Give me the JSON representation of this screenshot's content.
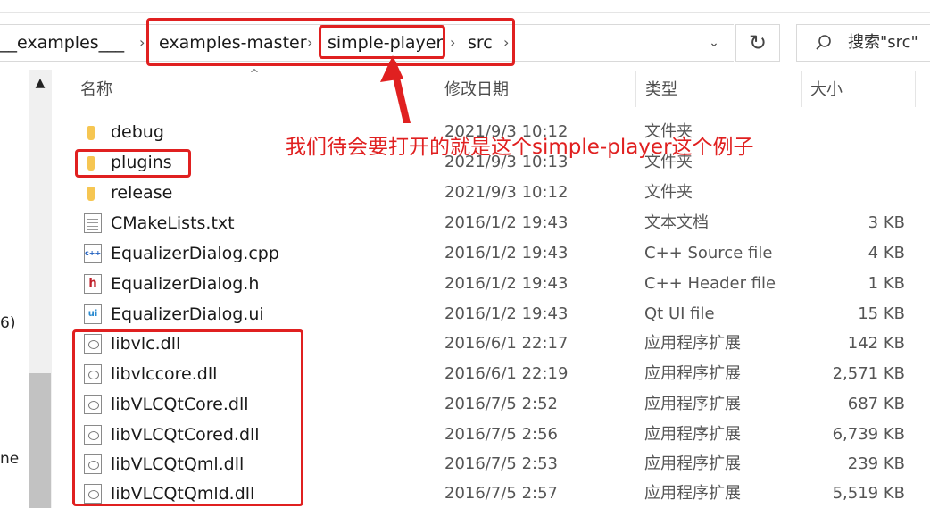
{
  "address_bar": {
    "crumbs": [
      "__examples___",
      "examples-master",
      "simple-player",
      "src"
    ],
    "separator": "›",
    "dropdown_glyph": "⌄",
    "refresh_glyph": "↻"
  },
  "search": {
    "placeholder": "搜索\"src\"",
    "icon": "search-icon"
  },
  "nav_pane": {
    "scroll_up_glyph": "▲",
    "fragments": [
      "6)",
      "ne"
    ]
  },
  "columns": {
    "name": "名称",
    "modified": "修改日期",
    "type": "类型",
    "size": "大小",
    "sort_glyph": "^"
  },
  "files": [
    {
      "name": "debug",
      "modified": "2021/9/3 10:12",
      "type": "文件夹",
      "size": "",
      "icon": "folder-icon"
    },
    {
      "name": "plugins",
      "modified": "2021/9/3 10:13",
      "type": "文件夹",
      "size": "",
      "icon": "folder-icon"
    },
    {
      "name": "release",
      "modified": "2021/9/3 10:12",
      "type": "文件夹",
      "size": "",
      "icon": "folder-icon"
    },
    {
      "name": "CMakeLists.txt",
      "modified": "2016/1/2 19:43",
      "type": "文本文档",
      "size": "3 KB",
      "icon": "text-file-icon"
    },
    {
      "name": "EqualizerDialog.cpp",
      "modified": "2016/1/2 19:43",
      "type": "C++ Source file",
      "size": "4 KB",
      "icon": "cpp-file-icon"
    },
    {
      "name": "EqualizerDialog.h",
      "modified": "2016/1/2 19:43",
      "type": "C++ Header file",
      "size": "1 KB",
      "icon": "header-file-icon"
    },
    {
      "name": "EqualizerDialog.ui",
      "modified": "2016/1/2 19:43",
      "type": "Qt UI file",
      "size": "15 KB",
      "icon": "ui-file-icon"
    },
    {
      "name": "libvlc.dll",
      "modified": "2016/6/1 22:17",
      "type": "应用程序扩展",
      "size": "142 KB",
      "icon": "dll-file-icon"
    },
    {
      "name": "libvlccore.dll",
      "modified": "2016/6/1 22:19",
      "type": "应用程序扩展",
      "size": "2,571 KB",
      "icon": "dll-file-icon"
    },
    {
      "name": "libVLCQtCore.dll",
      "modified": "2016/7/5 2:52",
      "type": "应用程序扩展",
      "size": "687 KB",
      "icon": "dll-file-icon"
    },
    {
      "name": "libVLCQtCored.dll",
      "modified": "2016/7/5 2:56",
      "type": "应用程序扩展",
      "size": "6,739 KB",
      "icon": "dll-file-icon"
    },
    {
      "name": "libVLCQtQml.dll",
      "modified": "2016/7/5 2:53",
      "type": "应用程序扩展",
      "size": "239 KB",
      "icon": "dll-file-icon"
    },
    {
      "name": "libVLCQtQmld.dll",
      "modified": "2016/7/5 2:57",
      "type": "应用程序扩展",
      "size": "5,519 KB",
      "icon": "dll-file-icon"
    }
  ],
  "annotation": {
    "text": "我们待会要打开的就是这个simple-player这个例子",
    "color": "#e02020"
  },
  "colors": {
    "folder": "#f6c652",
    "annotation": "#e02020"
  }
}
